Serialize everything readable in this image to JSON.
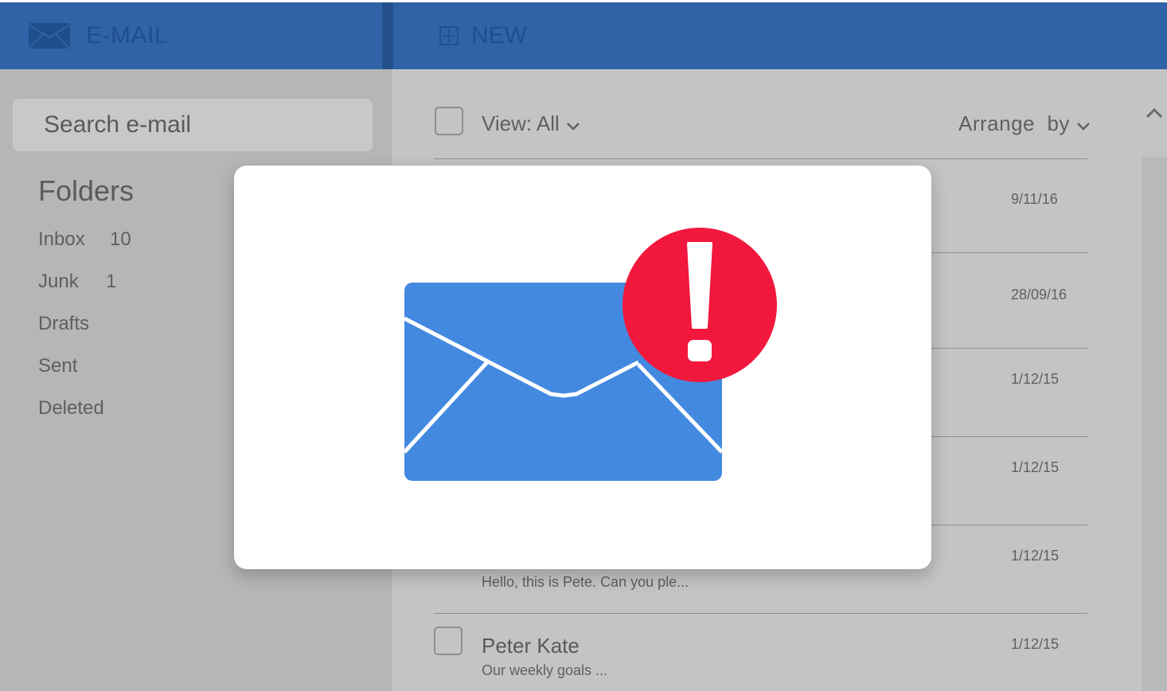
{
  "header": {
    "brand_label": "E-MAIL",
    "new_label": "NEW"
  },
  "sidebar": {
    "search_placeholder": "Search e-mail",
    "folders_title": "Folders",
    "folders": [
      {
        "label": "Inbox",
        "count": "10"
      },
      {
        "label": "Junk",
        "count": "1"
      },
      {
        "label": "Drafts",
        "count": ""
      },
      {
        "label": "Sent",
        "count": ""
      },
      {
        "label": "Deleted",
        "count": ""
      }
    ]
  },
  "toolbar": {
    "view_label": "View: All",
    "arrange_label": "Arrange  by"
  },
  "messages": [
    {
      "date": "9/11/16",
      "sender": "",
      "preview": ""
    },
    {
      "date": "28/09/16",
      "sender": "",
      "preview": ""
    },
    {
      "date": "1/12/15",
      "sender": "",
      "preview": ""
    },
    {
      "date": "1/12/15",
      "sender": "",
      "preview": ""
    },
    {
      "date": "1/12/15",
      "sender": "",
      "preview": "Hello, this is Pete. Can you ple..."
    },
    {
      "date": "1/12/15",
      "sender": "Peter Kate",
      "preview": "Our weekly goals ..."
    }
  ],
  "modal": {
    "icon": "envelope-alert-icon",
    "alert_mark": "!"
  },
  "colors": {
    "header_bg": "#2f62a6",
    "header_text": "#1e4f8c",
    "envelope": "#4389e0",
    "alert": "#f2173c",
    "overlay_bg": "#c4c4c4"
  }
}
